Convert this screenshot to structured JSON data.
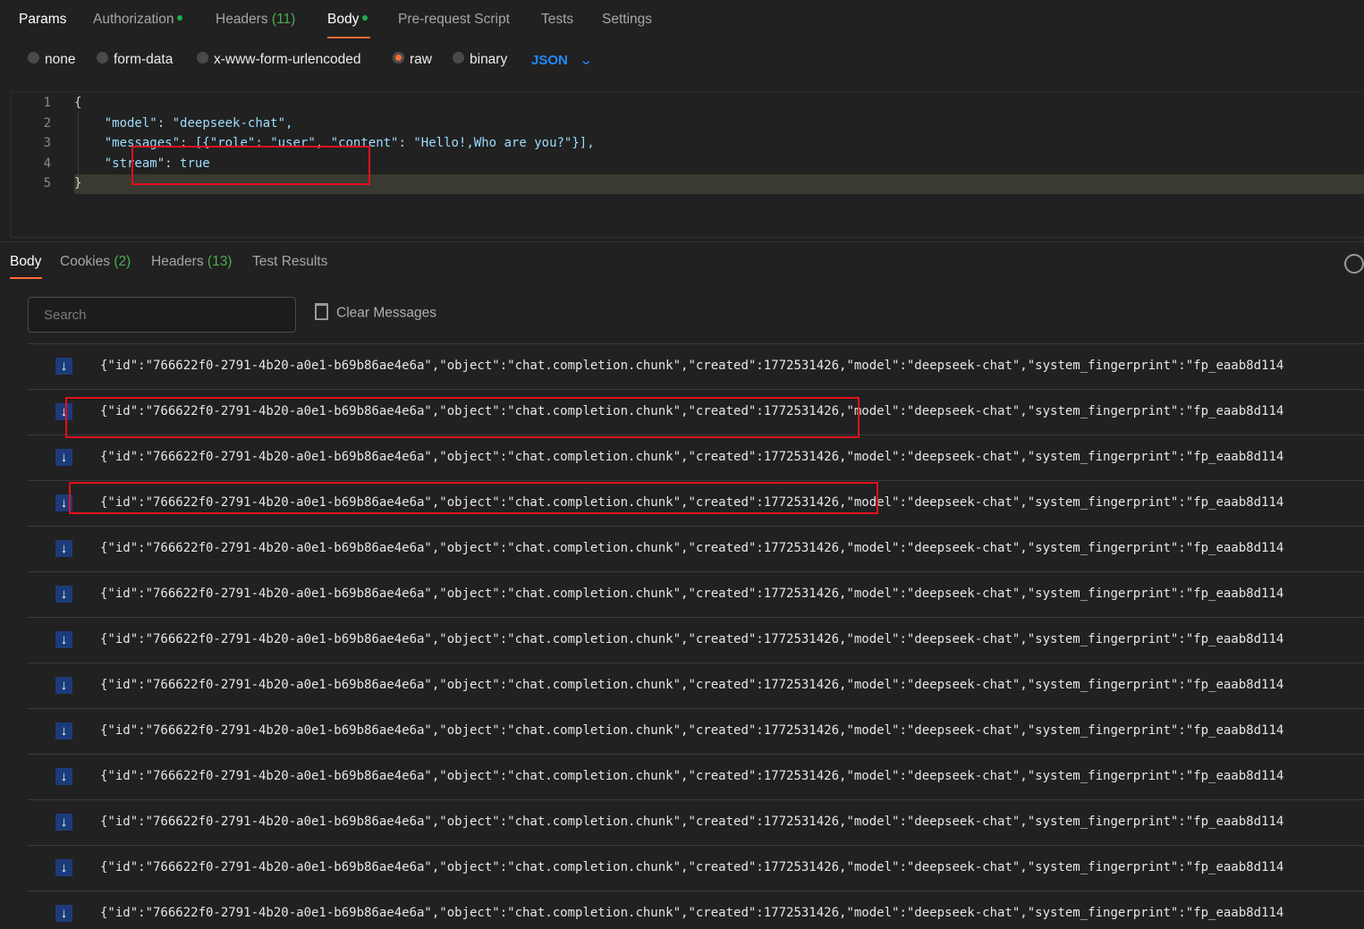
{
  "request_tabs": [
    {
      "label": "Params",
      "active": true
    },
    {
      "label": "Authorization",
      "dot": true
    },
    {
      "label": "Headers",
      "count": "(11)"
    },
    {
      "label": "Body",
      "dot": true,
      "selected": true
    },
    {
      "label": "Pre-request Script"
    },
    {
      "label": "Tests"
    },
    {
      "label": "Settings"
    }
  ],
  "body_types": [
    {
      "label": "none",
      "selected": false
    },
    {
      "label": "form-data",
      "selected": false
    },
    {
      "label": "x-www-form-urlencoded",
      "selected": false
    },
    {
      "label": "raw",
      "selected": true
    },
    {
      "label": "binary",
      "selected": false
    }
  ],
  "format_select": "JSON",
  "editor": {
    "line_numbers": [
      "1",
      "2",
      "3",
      "4",
      "5"
    ],
    "lines": [
      "{",
      "    \"model\": \"deepseek-chat\",",
      "    \"messages\": [{\"role\": \"user\", \"content\": \"Hello!,Who are you?\"}],",
      "    \"stream\": true",
      "}"
    ]
  },
  "response_tabs": [
    {
      "label": "Body",
      "active": true
    },
    {
      "label": "Cookies",
      "count": "(2)"
    },
    {
      "label": "Headers",
      "count": "(13)"
    },
    {
      "label": "Test Results"
    }
  ],
  "search_placeholder": "Search",
  "clear_label": "Clear Messages",
  "message_text": "{\"id\":\"766622f0-2791-4b20-a0e1-b69b86ae4e6a\",\"object\":\"chat.completion.chunk\",\"created\":1772531426,\"model\":\"deepseek-chat\",\"system_fingerprint\":\"fp_eaab8d114",
  "message_count": 13,
  "colors": {
    "accent": "#ff6c37",
    "highlight_box": "#e3101c",
    "count_green": "#4caf50",
    "json_blue": "#1f8cff"
  }
}
